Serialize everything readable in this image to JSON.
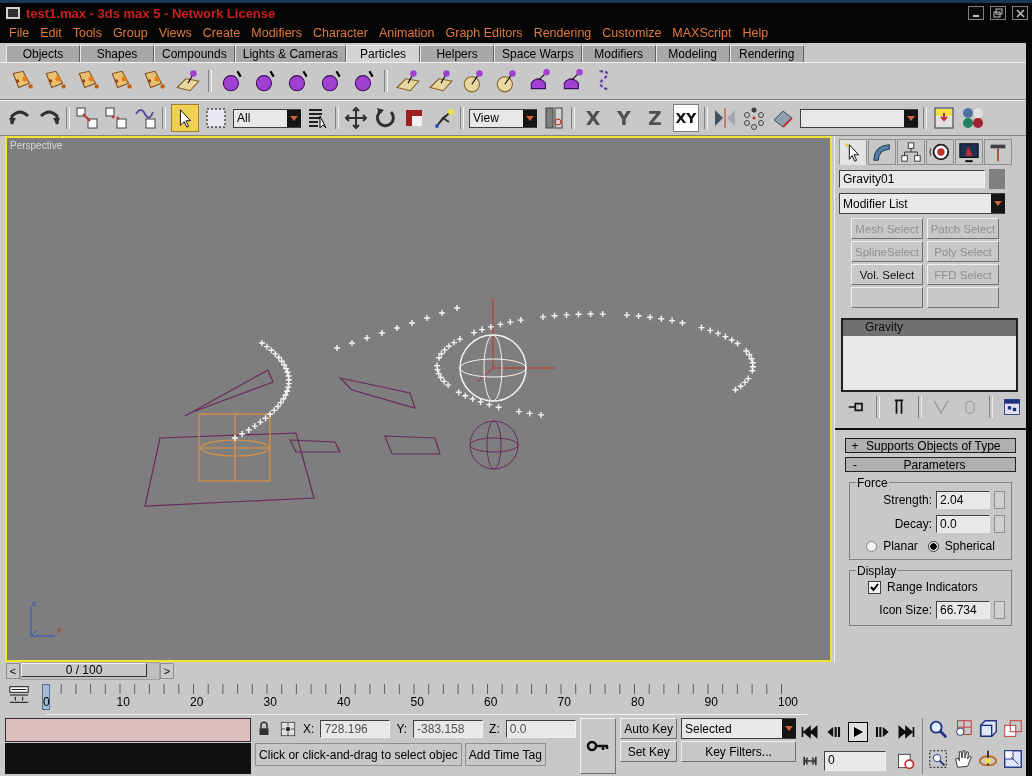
{
  "window": {
    "title": "test1.max - 3ds max 5 - Network License"
  },
  "menu": [
    "File",
    "Edit",
    "Tools",
    "Group",
    "Views",
    "Create",
    "Modifiers",
    "Character",
    "Animation",
    "Graph Editors",
    "Rendering",
    "Customize",
    "MAXScript",
    "Help"
  ],
  "tabs": [
    {
      "label": "Objects",
      "selected": false
    },
    {
      "label": "Shapes",
      "selected": false
    },
    {
      "label": "Compounds",
      "selected": false
    },
    {
      "label": "Lights & Cameras",
      "selected": false
    },
    {
      "label": "Particles",
      "selected": true
    },
    {
      "label": "Helpers",
      "selected": false
    },
    {
      "label": "Space Warps",
      "selected": false
    },
    {
      "label": "Modifiers",
      "selected": false
    },
    {
      "label": "Modeling",
      "selected": false
    },
    {
      "label": "Rendering",
      "selected": false
    }
  ],
  "toolbar": {
    "select_button": {
      "selected": true
    },
    "filter": "All",
    "ref_coord": "View",
    "axes": [
      {
        "label": "X",
        "selected": false
      },
      {
        "label": "Y",
        "selected": false
      },
      {
        "label": "Z",
        "selected": false
      },
      {
        "label": "XY",
        "selected": true
      }
    ]
  },
  "viewport": {
    "label": "Perspective",
    "axis_labels": [
      "z",
      "y"
    ]
  },
  "command_panel": {
    "tabs": [
      {
        "selected": true
      },
      {
        "selected": false
      },
      {
        "selected": false
      },
      {
        "selected": false
      },
      {
        "selected": false
      },
      {
        "selected": false
      }
    ],
    "object_name": "Gravity01",
    "modifier_list": "Modifier List",
    "modifier_buttons": [
      {
        "label": "Mesh Select",
        "disabled": true
      },
      {
        "label": "Patch Select",
        "disabled": true
      },
      {
        "label": "SplineSelect",
        "disabled": true
      },
      {
        "label": "Poly Select",
        "disabled": true
      },
      {
        "label": "Vol. Select",
        "disabled": false
      },
      {
        "label": "FFD Select",
        "disabled": true
      }
    ],
    "stack": [
      {
        "label": "Gravity",
        "selected": true
      }
    ],
    "rollouts": [
      {
        "sign": "+",
        "title": "Supports Objects of Type",
        "expanded": false
      },
      {
        "sign": "-",
        "title": "Parameters",
        "expanded": true
      }
    ],
    "force": {
      "title": "Force",
      "strength": {
        "label": "Strength:",
        "value": "2.04"
      },
      "decay": {
        "label": "Decay:",
        "value": "0.0"
      },
      "options": [
        {
          "label": "Planar",
          "selected": false
        },
        {
          "label": "Spherical",
          "selected": true
        }
      ]
    },
    "display": {
      "title": "Display",
      "range_indicators": {
        "label": "Range Indicators",
        "checked": true
      },
      "icon_size": {
        "label": "Icon Size:",
        "value": "66.734"
      }
    }
  },
  "time_slider": {
    "prev": "<",
    "label": "0 / 100",
    "next": ">"
  },
  "trackbar": {
    "ticks": [
      "0",
      "10",
      "20",
      "30",
      "40",
      "50",
      "60",
      "70",
      "80",
      "90",
      "100"
    ]
  },
  "status": {
    "coords": [
      {
        "axis": "X:",
        "value": "728.196"
      },
      {
        "axis": "Y:",
        "value": "-383.158"
      },
      {
        "axis": "Z:",
        "value": "0.0"
      }
    ],
    "prompt": "Click or click-and-drag to select objec",
    "time_tag": "Add Time Tag",
    "auto_key": {
      "label": "Auto Key",
      "on": false
    },
    "set_key": "Set Key",
    "key_mode": "Selected",
    "key_filters": "Key Filters...",
    "frame": "0"
  }
}
